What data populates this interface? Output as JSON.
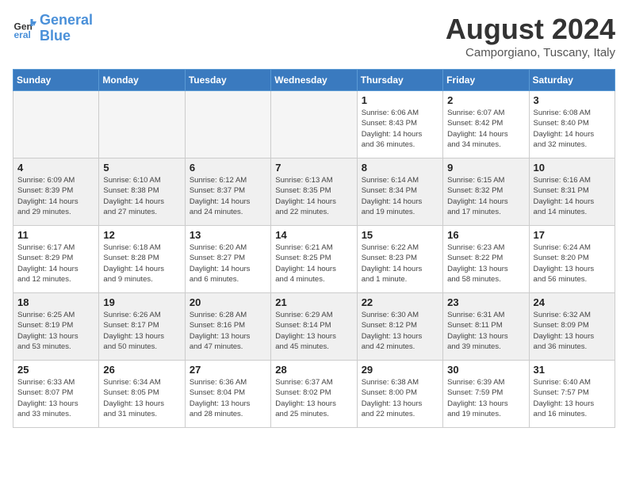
{
  "header": {
    "logo_text_general": "General",
    "logo_text_blue": "Blue",
    "month_year": "August 2024",
    "location": "Camporgiano, Tuscany, Italy"
  },
  "weekdays": [
    "Sunday",
    "Monday",
    "Tuesday",
    "Wednesday",
    "Thursday",
    "Friday",
    "Saturday"
  ],
  "weeks": [
    [
      {
        "day": "",
        "info": "",
        "empty": true
      },
      {
        "day": "",
        "info": "",
        "empty": true
      },
      {
        "day": "",
        "info": "",
        "empty": true
      },
      {
        "day": "",
        "info": "",
        "empty": true
      },
      {
        "day": "1",
        "info": "Sunrise: 6:06 AM\nSunset: 8:43 PM\nDaylight: 14 hours\nand 36 minutes.",
        "empty": false
      },
      {
        "day": "2",
        "info": "Sunrise: 6:07 AM\nSunset: 8:42 PM\nDaylight: 14 hours\nand 34 minutes.",
        "empty": false
      },
      {
        "day": "3",
        "info": "Sunrise: 6:08 AM\nSunset: 8:40 PM\nDaylight: 14 hours\nand 32 minutes.",
        "empty": false
      }
    ],
    [
      {
        "day": "4",
        "info": "Sunrise: 6:09 AM\nSunset: 8:39 PM\nDaylight: 14 hours\nand 29 minutes.",
        "empty": false
      },
      {
        "day": "5",
        "info": "Sunrise: 6:10 AM\nSunset: 8:38 PM\nDaylight: 14 hours\nand 27 minutes.",
        "empty": false
      },
      {
        "day": "6",
        "info": "Sunrise: 6:12 AM\nSunset: 8:37 PM\nDaylight: 14 hours\nand 24 minutes.",
        "empty": false
      },
      {
        "day": "7",
        "info": "Sunrise: 6:13 AM\nSunset: 8:35 PM\nDaylight: 14 hours\nand 22 minutes.",
        "empty": false
      },
      {
        "day": "8",
        "info": "Sunrise: 6:14 AM\nSunset: 8:34 PM\nDaylight: 14 hours\nand 19 minutes.",
        "empty": false
      },
      {
        "day": "9",
        "info": "Sunrise: 6:15 AM\nSunset: 8:32 PM\nDaylight: 14 hours\nand 17 minutes.",
        "empty": false
      },
      {
        "day": "10",
        "info": "Sunrise: 6:16 AM\nSunset: 8:31 PM\nDaylight: 14 hours\nand 14 minutes.",
        "empty": false
      }
    ],
    [
      {
        "day": "11",
        "info": "Sunrise: 6:17 AM\nSunset: 8:29 PM\nDaylight: 14 hours\nand 12 minutes.",
        "empty": false
      },
      {
        "day": "12",
        "info": "Sunrise: 6:18 AM\nSunset: 8:28 PM\nDaylight: 14 hours\nand 9 minutes.",
        "empty": false
      },
      {
        "day": "13",
        "info": "Sunrise: 6:20 AM\nSunset: 8:27 PM\nDaylight: 14 hours\nand 6 minutes.",
        "empty": false
      },
      {
        "day": "14",
        "info": "Sunrise: 6:21 AM\nSunset: 8:25 PM\nDaylight: 14 hours\nand 4 minutes.",
        "empty": false
      },
      {
        "day": "15",
        "info": "Sunrise: 6:22 AM\nSunset: 8:23 PM\nDaylight: 14 hours\nand 1 minute.",
        "empty": false
      },
      {
        "day": "16",
        "info": "Sunrise: 6:23 AM\nSunset: 8:22 PM\nDaylight: 13 hours\nand 58 minutes.",
        "empty": false
      },
      {
        "day": "17",
        "info": "Sunrise: 6:24 AM\nSunset: 8:20 PM\nDaylight: 13 hours\nand 56 minutes.",
        "empty": false
      }
    ],
    [
      {
        "day": "18",
        "info": "Sunrise: 6:25 AM\nSunset: 8:19 PM\nDaylight: 13 hours\nand 53 minutes.",
        "empty": false
      },
      {
        "day": "19",
        "info": "Sunrise: 6:26 AM\nSunset: 8:17 PM\nDaylight: 13 hours\nand 50 minutes.",
        "empty": false
      },
      {
        "day": "20",
        "info": "Sunrise: 6:28 AM\nSunset: 8:16 PM\nDaylight: 13 hours\nand 47 minutes.",
        "empty": false
      },
      {
        "day": "21",
        "info": "Sunrise: 6:29 AM\nSunset: 8:14 PM\nDaylight: 13 hours\nand 45 minutes.",
        "empty": false
      },
      {
        "day": "22",
        "info": "Sunrise: 6:30 AM\nSunset: 8:12 PM\nDaylight: 13 hours\nand 42 minutes.",
        "empty": false
      },
      {
        "day": "23",
        "info": "Sunrise: 6:31 AM\nSunset: 8:11 PM\nDaylight: 13 hours\nand 39 minutes.",
        "empty": false
      },
      {
        "day": "24",
        "info": "Sunrise: 6:32 AM\nSunset: 8:09 PM\nDaylight: 13 hours\nand 36 minutes.",
        "empty": false
      }
    ],
    [
      {
        "day": "25",
        "info": "Sunrise: 6:33 AM\nSunset: 8:07 PM\nDaylight: 13 hours\nand 33 minutes.",
        "empty": false
      },
      {
        "day": "26",
        "info": "Sunrise: 6:34 AM\nSunset: 8:05 PM\nDaylight: 13 hours\nand 31 minutes.",
        "empty": false
      },
      {
        "day": "27",
        "info": "Sunrise: 6:36 AM\nSunset: 8:04 PM\nDaylight: 13 hours\nand 28 minutes.",
        "empty": false
      },
      {
        "day": "28",
        "info": "Sunrise: 6:37 AM\nSunset: 8:02 PM\nDaylight: 13 hours\nand 25 minutes.",
        "empty": false
      },
      {
        "day": "29",
        "info": "Sunrise: 6:38 AM\nSunset: 8:00 PM\nDaylight: 13 hours\nand 22 minutes.",
        "empty": false
      },
      {
        "day": "30",
        "info": "Sunrise: 6:39 AM\nSunset: 7:59 PM\nDaylight: 13 hours\nand 19 minutes.",
        "empty": false
      },
      {
        "day": "31",
        "info": "Sunrise: 6:40 AM\nSunset: 7:57 PM\nDaylight: 13 hours\nand 16 minutes.",
        "empty": false
      }
    ]
  ]
}
